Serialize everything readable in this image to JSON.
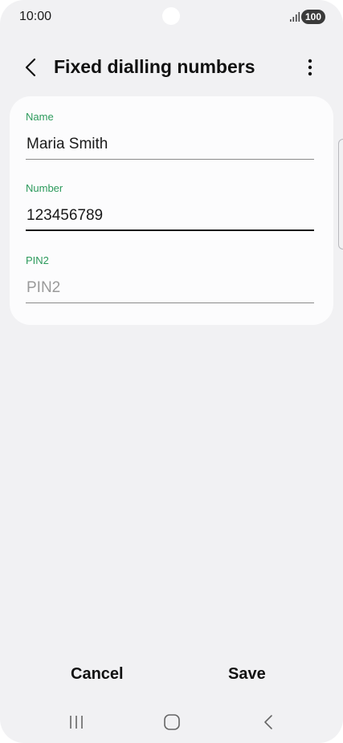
{
  "status_bar": {
    "time": "10:00",
    "battery": "100",
    "icons": [
      "signal-icon",
      "battery-icon"
    ]
  },
  "header": {
    "title": "Fixed dialling numbers",
    "icons": [
      "back-arrow-icon",
      "more-options-icon"
    ]
  },
  "form": {
    "fields": [
      {
        "label": "Name",
        "value": "Maria Smith",
        "placeholder": ""
      },
      {
        "label": "Number",
        "value": "123456789",
        "placeholder": ""
      },
      {
        "label": "PIN2",
        "value": "",
        "placeholder": "PIN2"
      }
    ]
  },
  "actions": {
    "cancel": "Cancel",
    "save": "Save"
  },
  "nav_bar": {
    "icons": [
      "recent-apps-icon",
      "home-icon",
      "back-icon"
    ]
  },
  "colors": {
    "background": "#f1f1f3",
    "card": "#fcfcfd",
    "label_accent": "#2c9a5c",
    "text": "#1a1a1a",
    "placeholder": "#9a9a9a"
  }
}
